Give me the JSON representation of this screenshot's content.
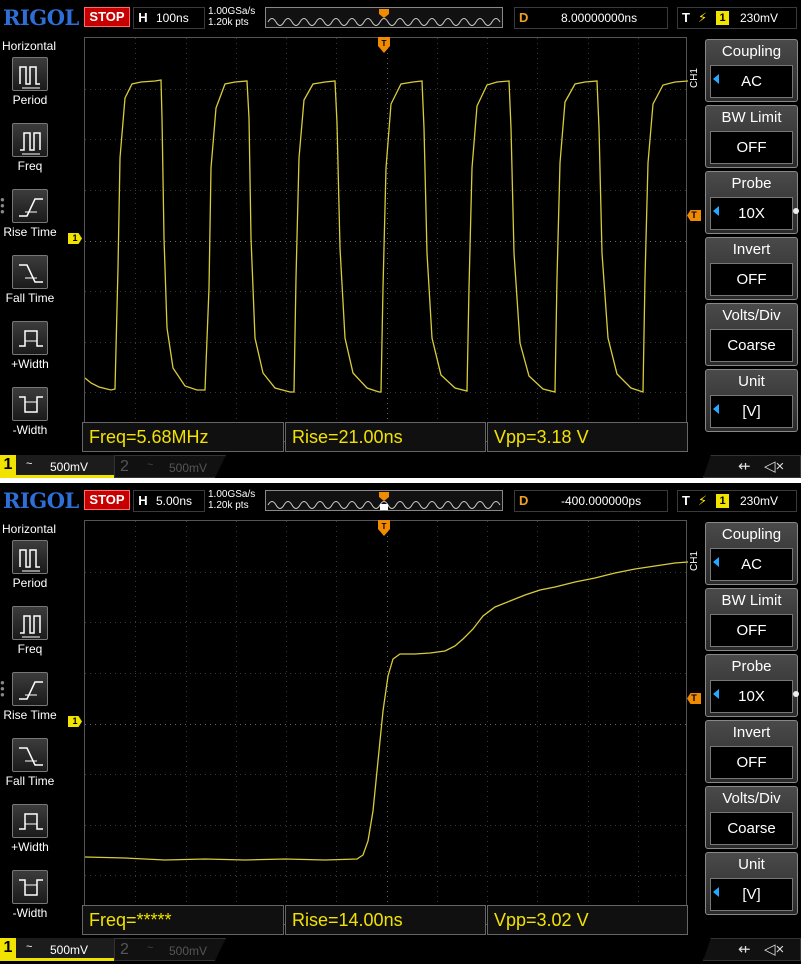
{
  "brand": "RIGOL",
  "colors": {
    "ch1": "#f2e200",
    "trigger": "#f08a00",
    "stop": "#c60000",
    "accent_arrow": "#27a8ff"
  },
  "screens": [
    {
      "run_state": "STOP",
      "timebase": {
        "label": "H",
        "value": "100ns"
      },
      "sample_rate": "1.00GSa/s",
      "memory_points": "1.20k pts",
      "delay": {
        "label": "D",
        "value": "8.00000000ns"
      },
      "trigger": {
        "label": "T",
        "edge_icon": "rising-edge-icon",
        "channel": "1",
        "level": "230mV"
      },
      "left_menu": {
        "title": "Horizontal",
        "items": [
          {
            "label": "Period",
            "icon": "period-icon"
          },
          {
            "label": "Freq",
            "icon": "freq-icon"
          },
          {
            "label": "Rise Time",
            "icon": "rise-time-icon"
          },
          {
            "label": "Fall Time",
            "icon": "fall-time-icon"
          },
          {
            "label": "+Width",
            "icon": "plus-width-icon"
          },
          {
            "label": "-Width",
            "icon": "minus-width-icon"
          }
        ]
      },
      "channel_label": "CH1",
      "ch1_marker": "1",
      "trig_marker": "T",
      "measurements": [
        "Freq=5.68MHz",
        "Rise=21.00ns",
        "Vpp=3.18 V"
      ],
      "right_menu": [
        {
          "title": "Coupling",
          "value": "AC",
          "arrow": true
        },
        {
          "title": "BW Limit",
          "value": "OFF",
          "arrow": false
        },
        {
          "title": "Probe",
          "value": "10X",
          "arrow": true
        },
        {
          "title": "Invert",
          "value": "OFF",
          "arrow": false
        },
        {
          "title": "Volts/Div",
          "value": "Coarse",
          "arrow": false
        },
        {
          "title": "Unit",
          "value": "[V]",
          "arrow": true
        }
      ],
      "channels": [
        {
          "number": "1",
          "coupling": "~",
          "scale": "500mV",
          "active": true
        },
        {
          "number": "2",
          "coupling": "~",
          "scale": "500mV",
          "active": false
        }
      ],
      "status_icons": [
        "usb-icon",
        "speaker-mute-icon"
      ]
    },
    {
      "run_state": "STOP",
      "timebase": {
        "label": "H",
        "value": "5.00ns"
      },
      "sample_rate": "1.00GSa/s",
      "memory_points": "1.20k pts",
      "delay": {
        "label": "D",
        "value": "-400.000000ps"
      },
      "trigger": {
        "label": "T",
        "edge_icon": "rising-edge-icon",
        "channel": "1",
        "level": "230mV"
      },
      "left_menu": {
        "title": "Horizontal",
        "items": [
          {
            "label": "Period",
            "icon": "period-icon"
          },
          {
            "label": "Freq",
            "icon": "freq-icon"
          },
          {
            "label": "Rise Time",
            "icon": "rise-time-icon"
          },
          {
            "label": "Fall Time",
            "icon": "fall-time-icon"
          },
          {
            "label": "+Width",
            "icon": "plus-width-icon"
          },
          {
            "label": "-Width",
            "icon": "minus-width-icon"
          }
        ]
      },
      "channel_label": "CH1",
      "ch1_marker": "1",
      "trig_marker": "T",
      "measurements": [
        "Freq=*****",
        "Rise=14.00ns",
        "Vpp=3.02 V"
      ],
      "right_menu": [
        {
          "title": "Coupling",
          "value": "AC",
          "arrow": true
        },
        {
          "title": "BW Limit",
          "value": "OFF",
          "arrow": false
        },
        {
          "title": "Probe",
          "value": "10X",
          "arrow": true
        },
        {
          "title": "Invert",
          "value": "OFF",
          "arrow": false
        },
        {
          "title": "Volts/Div",
          "value": "Coarse",
          "arrow": false
        },
        {
          "title": "Unit",
          "value": "[V]",
          "arrow": true
        }
      ],
      "channels": [
        {
          "number": "1",
          "coupling": "~",
          "scale": "500mV",
          "active": true
        },
        {
          "number": "2",
          "coupling": "~",
          "scale": "500mV",
          "active": false
        }
      ],
      "status_icons": [
        "usb-icon",
        "speaker-mute-icon"
      ]
    }
  ]
}
